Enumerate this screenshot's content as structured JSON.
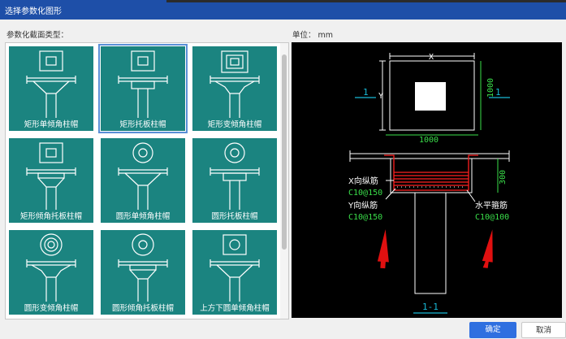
{
  "window": {
    "title": "选择参数化图形"
  },
  "left_panel": {
    "label": "参数化截面类型："
  },
  "preview_panel": {
    "unit_label": "单位：  mm"
  },
  "gallery": {
    "items": [
      {
        "label": "矩形单倾角柱帽",
        "selected": false
      },
      {
        "label": "矩形托板柱帽",
        "selected": true
      },
      {
        "label": "矩形变倾角柱帽",
        "selected": false
      },
      {
        "label": "矩形倾角托板柱帽",
        "selected": false
      },
      {
        "label": "圆形单倾角柱帽",
        "selected": false
      },
      {
        "label": "圆形托板柱帽",
        "selected": false
      },
      {
        "label": "圆形变倾角柱帽",
        "selected": false
      },
      {
        "label": "圆形倾角托板柱帽",
        "selected": false
      },
      {
        "label": "上方下圆单倾角柱帽",
        "selected": false
      }
    ]
  },
  "drawing": {
    "x_label": "X",
    "y_label": "Y",
    "section_mark": "1",
    "dim_width": "1000",
    "dim_height": "1000",
    "dim_thickness": "300",
    "x_rebar_label": "X向纵筋",
    "x_rebar_spec": "C10@150",
    "y_rebar_label": "Y向纵筋",
    "y_rebar_spec": "C10@150",
    "stirrup_label": "水平箍筋",
    "stirrup_spec": "C10@100",
    "section_title": "1-1"
  },
  "buttons": {
    "ok": "确定",
    "cancel": "取消"
  }
}
